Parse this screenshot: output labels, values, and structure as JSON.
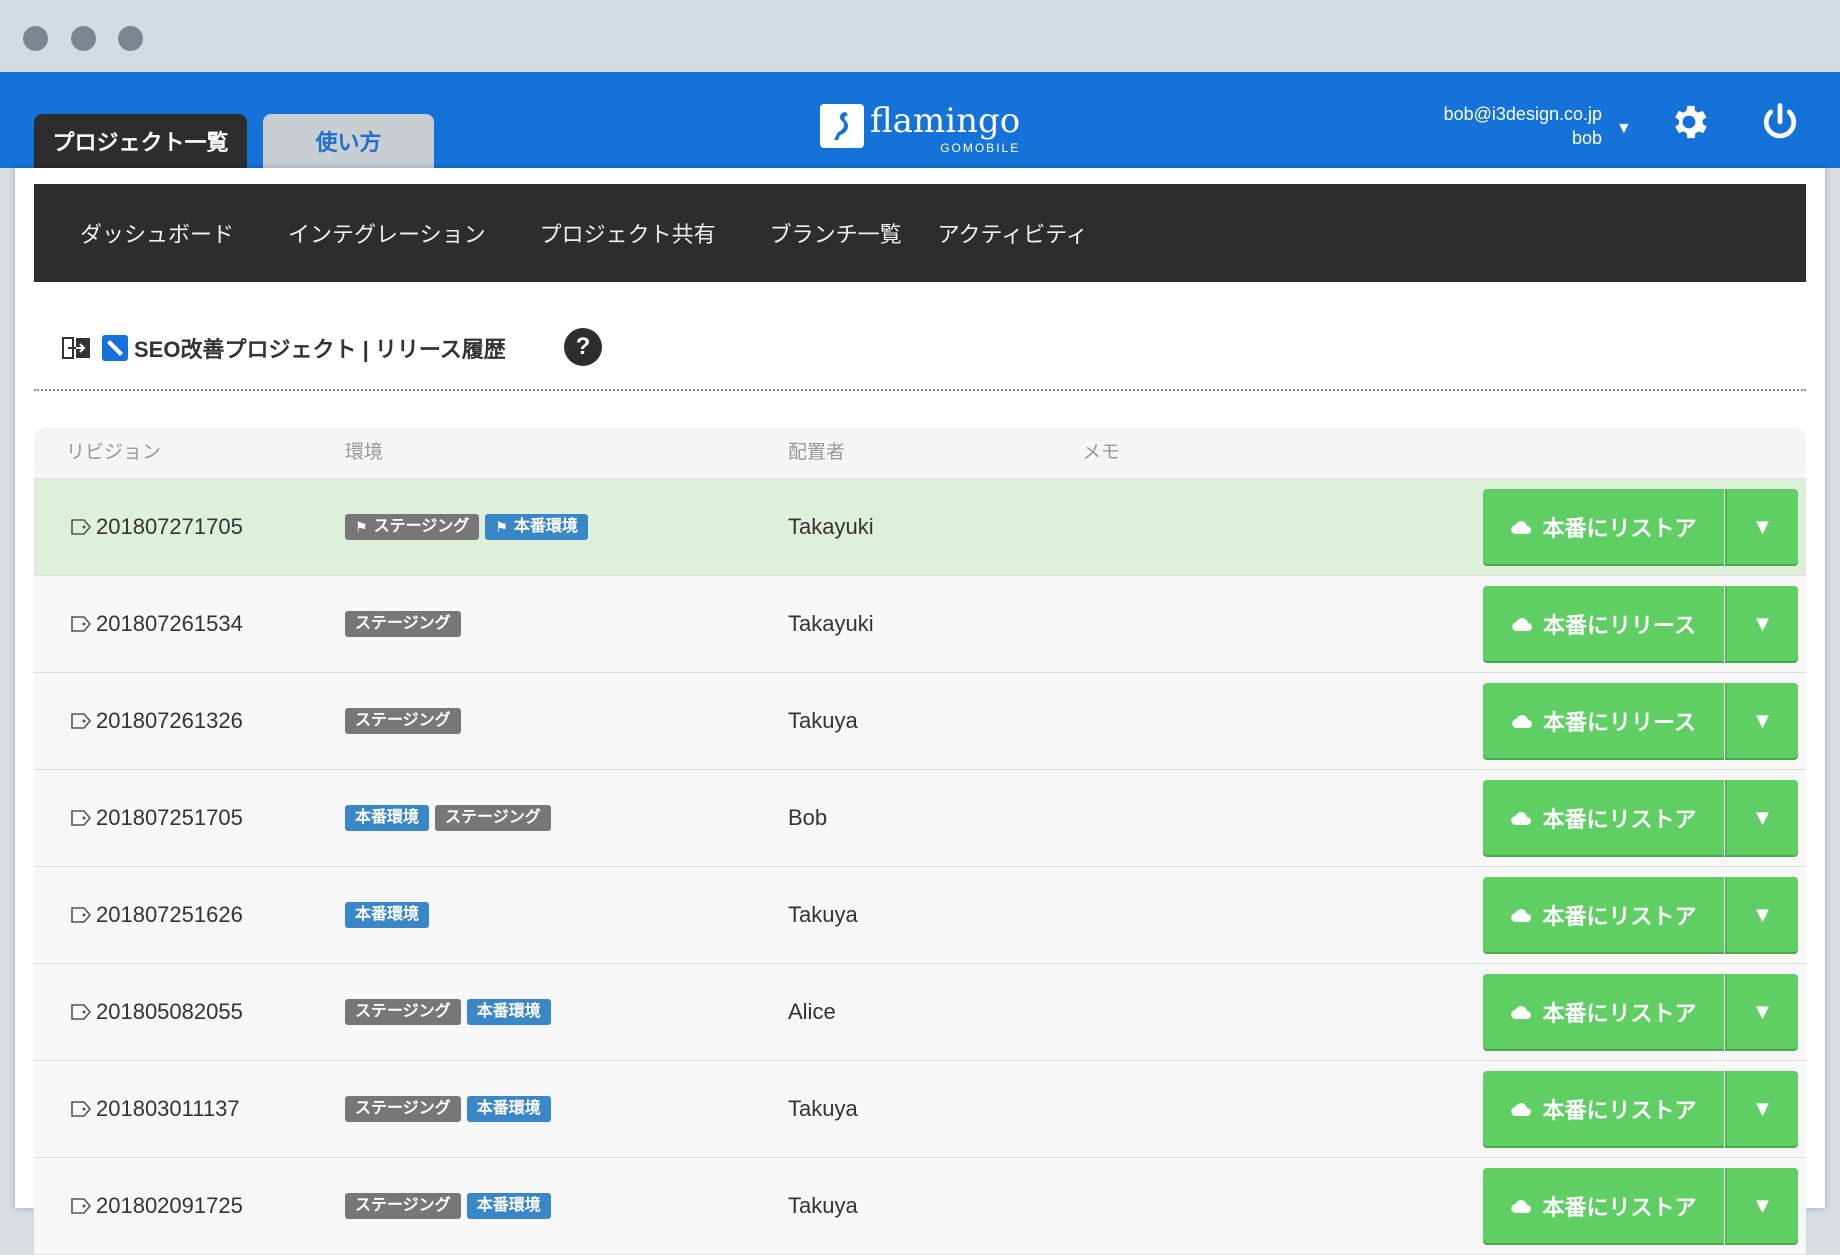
{
  "header": {
    "tabs": [
      {
        "label": "プロジェクト一覧",
        "active": true
      },
      {
        "label": "使い方",
        "active": false
      }
    ],
    "logo": {
      "name": "flamingo",
      "sub": "GOMOBILE"
    },
    "user": {
      "email": "bob@i3design.co.jp",
      "name": "bob"
    },
    "colors": {
      "primary": "#1472d8",
      "dark": "#2d2d2d",
      "action": "#5fce63",
      "prod_badge": "#3a87c8",
      "staging_badge": "#777777"
    }
  },
  "subnav": [
    "ダッシュボード",
    "インテグレーション",
    "プロジェクト共有",
    "ブランチ一覧",
    "アクティビティ"
  ],
  "page": {
    "title": "SEO改善プロジェクト | リリース履歴",
    "help": "?"
  },
  "table": {
    "columns": [
      "リビジョン",
      "環境",
      "配置者",
      "メモ"
    ],
    "rows": [
      {
        "revision": "201807271705",
        "envs": [
          {
            "label": "ステージング",
            "type": "staging",
            "flag": true
          },
          {
            "label": "本番環境",
            "type": "prod",
            "flag": true
          }
        ],
        "deployer": "Takayuki",
        "memo": "",
        "action": "本番にリストア",
        "current": true
      },
      {
        "revision": "201807261534",
        "envs": [
          {
            "label": "ステージング",
            "type": "staging",
            "flag": false
          }
        ],
        "deployer": "Takayuki",
        "memo": "",
        "action": "本番にリリース",
        "current": false
      },
      {
        "revision": "201807261326",
        "envs": [
          {
            "label": "ステージング",
            "type": "staging",
            "flag": false
          }
        ],
        "deployer": "Takuya",
        "memo": "",
        "action": "本番にリリース",
        "current": false
      },
      {
        "revision": "201807251705",
        "envs": [
          {
            "label": "本番環境",
            "type": "prod",
            "flag": false
          },
          {
            "label": "ステージング",
            "type": "staging",
            "flag": false
          }
        ],
        "deployer": "Bob",
        "memo": "",
        "action": "本番にリストア",
        "current": false
      },
      {
        "revision": "201807251626",
        "envs": [
          {
            "label": "本番環境",
            "type": "prod",
            "flag": false
          }
        ],
        "deployer": "Takuya",
        "memo": "",
        "action": "本番にリストア",
        "current": false
      },
      {
        "revision": "201805082055",
        "envs": [
          {
            "label": "ステージング",
            "type": "staging",
            "flag": false
          },
          {
            "label": "本番環境",
            "type": "prod",
            "flag": false
          }
        ],
        "deployer": "Alice",
        "memo": "",
        "action": "本番にリストア",
        "current": false
      },
      {
        "revision": "201803011137",
        "envs": [
          {
            "label": "ステージング",
            "type": "staging",
            "flag": false
          },
          {
            "label": "本番環境",
            "type": "prod",
            "flag": false
          }
        ],
        "deployer": "Takuya",
        "memo": "",
        "action": "本番にリストア",
        "current": false
      },
      {
        "revision": "201802091725",
        "envs": [
          {
            "label": "ステージング",
            "type": "staging",
            "flag": false
          },
          {
            "label": "本番環境",
            "type": "prod",
            "flag": false
          }
        ],
        "deployer": "Takuya",
        "memo": "",
        "action": "本番にリストア",
        "current": false
      }
    ]
  }
}
